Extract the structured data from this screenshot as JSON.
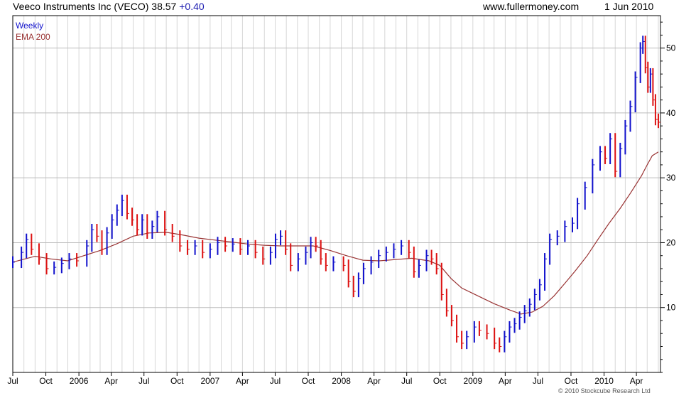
{
  "header": {
    "title": "Veeco Instruments Inc (VECO) 38.57",
    "change": "+0.40",
    "site": "www.fullermoney.com",
    "date": "1 Jun 2010"
  },
  "footer": {
    "copyright": "© 2010 Stockcube Research Ltd"
  },
  "colors": {
    "up": "#1111cc",
    "down": "#dd1111",
    "ema": "#993333",
    "grid": "#d6d6d6",
    "axis": "#000000"
  },
  "chart_data": {
    "type": "line",
    "title": "Veeco Instruments Inc (VECO)",
    "legend": [
      "Weekly",
      "EMA 200"
    ],
    "legend_position": "top-left",
    "grid": true,
    "y_axis_side": "right",
    "ylim": [
      0,
      55
    ],
    "yticks": [
      10,
      20,
      30,
      40,
      50
    ],
    "x_range": [
      "2005-07-01",
      "2010-06-07"
    ],
    "xticks": [
      {
        "label": "Jul",
        "date": "2005-07-01"
      },
      {
        "label": "Oct",
        "date": "2005-10-01"
      },
      {
        "label": "2006",
        "date": "2006-01-01"
      },
      {
        "label": "Apr",
        "date": "2006-04-01"
      },
      {
        "label": "Jul",
        "date": "2006-07-01"
      },
      {
        "label": "Oct",
        "date": "2006-10-01"
      },
      {
        "label": "2007",
        "date": "2007-01-01"
      },
      {
        "label": "Apr",
        "date": "2007-04-01"
      },
      {
        "label": "Jul",
        "date": "2007-07-01"
      },
      {
        "label": "Oct",
        "date": "2007-10-01"
      },
      {
        "label": "2008",
        "date": "2008-01-01"
      },
      {
        "label": "Apr",
        "date": "2008-04-01"
      },
      {
        "label": "Jul",
        "date": "2008-07-01"
      },
      {
        "label": "Oct",
        "date": "2008-10-01"
      },
      {
        "label": "2009",
        "date": "2009-01-01"
      },
      {
        "label": "Apr",
        "date": "2009-04-01"
      },
      {
        "label": "Jul",
        "date": "2009-07-01"
      },
      {
        "label": "Oct",
        "date": "2009-10-01"
      },
      {
        "label": "2010",
        "date": "2010-01-01"
      },
      {
        "label": "Apr",
        "date": "2010-04-01"
      }
    ],
    "series": [
      {
        "name": "Weekly",
        "points": [
          [
            "2005-07-01",
            17.0
          ],
          [
            "2005-07-25",
            18.5
          ],
          [
            "2005-08-08",
            20.5
          ],
          [
            "2005-08-22",
            19.0
          ],
          [
            "2005-09-12",
            17.5
          ],
          [
            "2005-10-03",
            16.0
          ],
          [
            "2005-10-24",
            16.2
          ],
          [
            "2005-11-14",
            16.8
          ],
          [
            "2005-12-05",
            17.5
          ],
          [
            "2005-12-26",
            17.2
          ],
          [
            "2006-01-23",
            19.5
          ],
          [
            "2006-02-06",
            22.0
          ],
          [
            "2006-02-20",
            21.0
          ],
          [
            "2006-03-06",
            19.0
          ],
          [
            "2006-03-20",
            21.5
          ],
          [
            "2006-04-03",
            23.5
          ],
          [
            "2006-04-17",
            25.0
          ],
          [
            "2006-05-01",
            26.5
          ],
          [
            "2006-05-15",
            24.5
          ],
          [
            "2006-05-29",
            23.5
          ],
          [
            "2006-06-12",
            22.0
          ],
          [
            "2006-06-26",
            23.5
          ],
          [
            "2006-07-10",
            21.5
          ],
          [
            "2006-07-24",
            22.5
          ],
          [
            "2006-08-07",
            24.0
          ],
          [
            "2006-08-28",
            22.0
          ],
          [
            "2006-09-18",
            21.0
          ],
          [
            "2006-10-09",
            19.5
          ],
          [
            "2006-10-30",
            19.0
          ],
          [
            "2006-11-20",
            19.5
          ],
          [
            "2006-12-11",
            18.5
          ],
          [
            "2007-01-01",
            19.0
          ],
          [
            "2007-01-22",
            20.0
          ],
          [
            "2007-02-12",
            19.5
          ],
          [
            "2007-03-05",
            19.8
          ],
          [
            "2007-03-26",
            19.0
          ],
          [
            "2007-04-16",
            19.5
          ],
          [
            "2007-05-07",
            18.5
          ],
          [
            "2007-05-28",
            17.5
          ],
          [
            "2007-06-18",
            18.5
          ],
          [
            "2007-07-02",
            20.5
          ],
          [
            "2007-07-16",
            21.0
          ],
          [
            "2007-07-30",
            19.0
          ],
          [
            "2007-08-13",
            16.5
          ],
          [
            "2007-09-03",
            17.5
          ],
          [
            "2007-09-24",
            18.5
          ],
          [
            "2007-10-08",
            20.0
          ],
          [
            "2007-10-22",
            19.5
          ],
          [
            "2007-11-05",
            17.5
          ],
          [
            "2007-11-19",
            16.5
          ],
          [
            "2007-12-10",
            17.0
          ],
          [
            "2008-01-07",
            16.5
          ],
          [
            "2008-01-21",
            14.0
          ],
          [
            "2008-02-04",
            12.5
          ],
          [
            "2008-02-18",
            14.5
          ],
          [
            "2008-03-03",
            16.0
          ],
          [
            "2008-03-24",
            17.0
          ],
          [
            "2008-04-14",
            18.0
          ],
          [
            "2008-05-05",
            18.5
          ],
          [
            "2008-05-26",
            19.0
          ],
          [
            "2008-06-16",
            19.5
          ],
          [
            "2008-07-07",
            18.5
          ],
          [
            "2008-07-21",
            15.5
          ],
          [
            "2008-08-04",
            16.5
          ],
          [
            "2008-08-25",
            18.0
          ],
          [
            "2008-09-08",
            17.5
          ],
          [
            "2008-09-22",
            16.0
          ],
          [
            "2008-10-06",
            12.0
          ],
          [
            "2008-10-20",
            9.5
          ],
          [
            "2008-11-03",
            8.0
          ],
          [
            "2008-11-17",
            5.5
          ],
          [
            "2008-12-01",
            4.5
          ],
          [
            "2008-12-15",
            5.5
          ],
          [
            "2009-01-05",
            7.0
          ],
          [
            "2009-01-19",
            6.5
          ],
          [
            "2009-02-09",
            6.0
          ],
          [
            "2009-03-02",
            4.5
          ],
          [
            "2009-03-16",
            4.0
          ],
          [
            "2009-03-30",
            5.5
          ],
          [
            "2009-04-13",
            7.0
          ],
          [
            "2009-04-27",
            7.5
          ],
          [
            "2009-05-11",
            8.5
          ],
          [
            "2009-05-25",
            9.5
          ],
          [
            "2009-06-08",
            10.5
          ],
          [
            "2009-06-22",
            12.0
          ],
          [
            "2009-07-06",
            13.5
          ],
          [
            "2009-07-20",
            17.5
          ],
          [
            "2009-08-03",
            20.5
          ],
          [
            "2009-08-24",
            21.0
          ],
          [
            "2009-09-14",
            22.5
          ],
          [
            "2009-10-05",
            23.0
          ],
          [
            "2009-10-19",
            26.0
          ],
          [
            "2009-11-09",
            28.5
          ],
          [
            "2009-11-30",
            32.0
          ],
          [
            "2009-12-21",
            34.0
          ],
          [
            "2010-01-04",
            33.0
          ],
          [
            "2010-01-18",
            36.0
          ],
          [
            "2010-02-01",
            31.0
          ],
          [
            "2010-02-15",
            34.5
          ],
          [
            "2010-03-01",
            38.0
          ],
          [
            "2010-03-15",
            41.0
          ],
          [
            "2010-03-29",
            45.5
          ],
          [
            "2010-04-12",
            50.0
          ],
          [
            "2010-04-19",
            51.0
          ],
          [
            "2010-04-26",
            47.0
          ],
          [
            "2010-05-03",
            44.0
          ],
          [
            "2010-05-10",
            46.0
          ],
          [
            "2010-05-17",
            42.0
          ],
          [
            "2010-05-24",
            39.0
          ],
          [
            "2010-06-01",
            38.57
          ]
        ]
      },
      {
        "name": "EMA 200",
        "points": [
          [
            "2005-07-01",
            17.0
          ],
          [
            "2005-09-01",
            17.9
          ],
          [
            "2005-10-15",
            17.5
          ],
          [
            "2005-12-01",
            17.2
          ],
          [
            "2006-01-15",
            18.0
          ],
          [
            "2006-03-01",
            18.8
          ],
          [
            "2006-04-15",
            19.8
          ],
          [
            "2006-06-01",
            21.0
          ],
          [
            "2006-07-15",
            21.5
          ],
          [
            "2006-09-01",
            21.6
          ],
          [
            "2006-10-15",
            21.2
          ],
          [
            "2006-12-01",
            20.7
          ],
          [
            "2007-01-15",
            20.4
          ],
          [
            "2007-03-01",
            20.1
          ],
          [
            "2007-04-15",
            19.8
          ],
          [
            "2007-06-01",
            19.6
          ],
          [
            "2007-07-15",
            19.5
          ],
          [
            "2007-09-01",
            19.5
          ],
          [
            "2007-10-15",
            19.5
          ],
          [
            "2007-12-01",
            18.8
          ],
          [
            "2008-01-15",
            18.0
          ],
          [
            "2008-03-01",
            17.3
          ],
          [
            "2008-04-15",
            17.2
          ],
          [
            "2008-06-01",
            17.4
          ],
          [
            "2008-07-15",
            17.6
          ],
          [
            "2008-09-01",
            17.2
          ],
          [
            "2008-10-01",
            16.5
          ],
          [
            "2008-11-01",
            14.5
          ],
          [
            "2008-12-01",
            13.0
          ],
          [
            "2009-01-15",
            11.8
          ],
          [
            "2009-03-01",
            10.6
          ],
          [
            "2009-04-15",
            9.6
          ],
          [
            "2009-05-15",
            9.0
          ],
          [
            "2009-06-15",
            9.3
          ],
          [
            "2009-07-15",
            10.2
          ],
          [
            "2009-08-15",
            11.8
          ],
          [
            "2009-09-15",
            13.8
          ],
          [
            "2009-10-15",
            15.8
          ],
          [
            "2009-11-15",
            18.0
          ],
          [
            "2009-12-15",
            20.5
          ],
          [
            "2010-01-15",
            23.0
          ],
          [
            "2010-02-15",
            25.3
          ],
          [
            "2010-03-15",
            27.6
          ],
          [
            "2010-04-15",
            30.3
          ],
          [
            "2010-05-01",
            32.0
          ],
          [
            "2010-05-15",
            33.4
          ],
          [
            "2010-06-01",
            34.0
          ]
        ]
      }
    ]
  }
}
